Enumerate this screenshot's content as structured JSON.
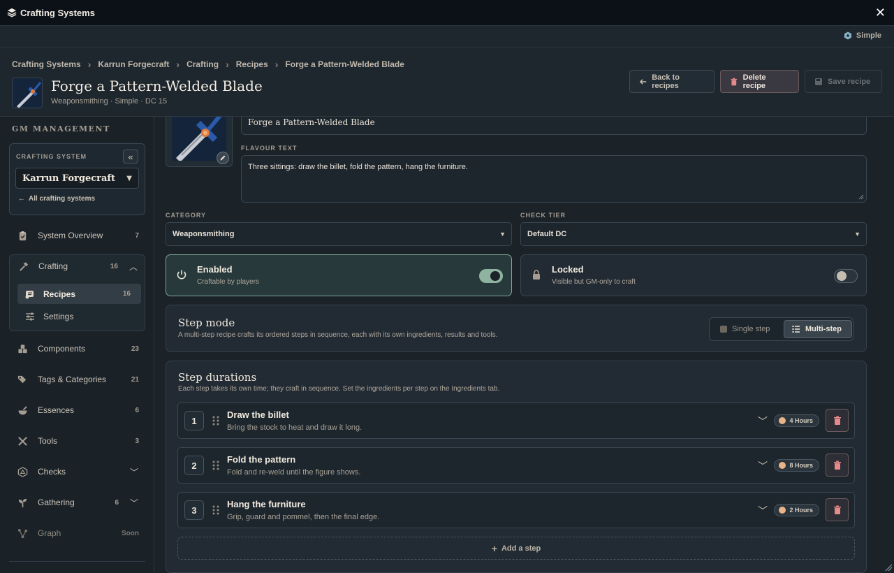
{
  "window": {
    "title": "Crafting Systems",
    "close_glyph": "✕"
  },
  "mode": {
    "label": "Simple",
    "icon": "dice-icon"
  },
  "breadcrumb": [
    "Crafting Systems",
    "Karrun Forgecraft",
    "Crafting",
    "Recipes",
    "Forge a Pattern-Welded Blade"
  ],
  "header": {
    "title": "Forge a Pattern-Welded Blade",
    "subtitle": "Weaponsmithing · Simple · DC 15",
    "back_label": "Back to recipes",
    "delete_label": "Delete recipe",
    "save_label": "Save recipe"
  },
  "sidebar": {
    "section_title": "GM MANAGEMENT",
    "crafting_system_label": "CRAFTING SYSTEM",
    "collapse_glyph": "«",
    "crafting_system_value": "Karrun Forgecraft",
    "all_systems_label": "All crafting systems",
    "items": [
      {
        "label": "System Overview",
        "count": "7",
        "icon": "clipboard-icon"
      },
      {
        "label": "Crafting",
        "count": "16",
        "icon": "hammer-icon"
      },
      {
        "label": "Components",
        "count": "23",
        "icon": "boxes-icon"
      },
      {
        "label": "Tags & Categories",
        "count": "21",
        "icon": "tags-icon"
      },
      {
        "label": "Essences",
        "count": "6",
        "icon": "mortar-icon"
      },
      {
        "label": "Tools",
        "count": "3",
        "icon": "tools-icon"
      },
      {
        "label": "Checks",
        "count": "",
        "icon": "d20-icon"
      },
      {
        "label": "Gathering",
        "count": "6",
        "icon": "sprout-icon"
      },
      {
        "label": "Graph",
        "count": "Soon",
        "icon": "graph-icon"
      }
    ],
    "crafting_sub": [
      {
        "label": "Recipes",
        "count": "16",
        "icon": "scroll-icon"
      },
      {
        "label": "Settings",
        "count": "",
        "icon": "sliders-icon"
      }
    ]
  },
  "form": {
    "name_value": "Forge a Pattern-Welded Blade",
    "flavour_label": "FLAVOUR TEXT",
    "flavour_value": "Three sittings: draw the billet, fold the pattern, hang the furniture.",
    "category_label": "CATEGORY",
    "category_value": "Weaponsmithing",
    "check_tier_label": "CHECK TIER",
    "check_tier_value": "Default DC",
    "enabled": {
      "title": "Enabled",
      "sub": "Craftable by players",
      "on": true
    },
    "locked": {
      "title": "Locked",
      "sub": "Visible but GM-only to craft",
      "on": false
    }
  },
  "step_mode": {
    "title": "Step mode",
    "desc": "A multi-step recipe crafts its ordered steps in sequence, each with its own ingredients, results and tools.",
    "single_label": "Single step",
    "multi_label": "Multi-step",
    "selected": "Multi-step"
  },
  "durations": {
    "title": "Step durations",
    "desc": "Each step takes its own time; they craft in sequence. Set the ingredients per step on the Ingredients tab.",
    "steps": [
      {
        "num": "1",
        "title": "Draw the billet",
        "desc": "Bring the stock to heat and draw it long.",
        "duration": "4 Hours"
      },
      {
        "num": "2",
        "title": "Fold the pattern",
        "desc": "Fold and re-weld until the figure shows.",
        "duration": "8 Hours"
      },
      {
        "num": "3",
        "title": "Hang the furniture",
        "desc": "Grip, guard and pommel, then the final edge.",
        "duration": "2 Hours"
      }
    ],
    "add_label": "Add a step"
  },
  "colors": {
    "accent_green": "#8fb3a0",
    "danger": "#e58a8a",
    "bg": "#1b2329"
  }
}
